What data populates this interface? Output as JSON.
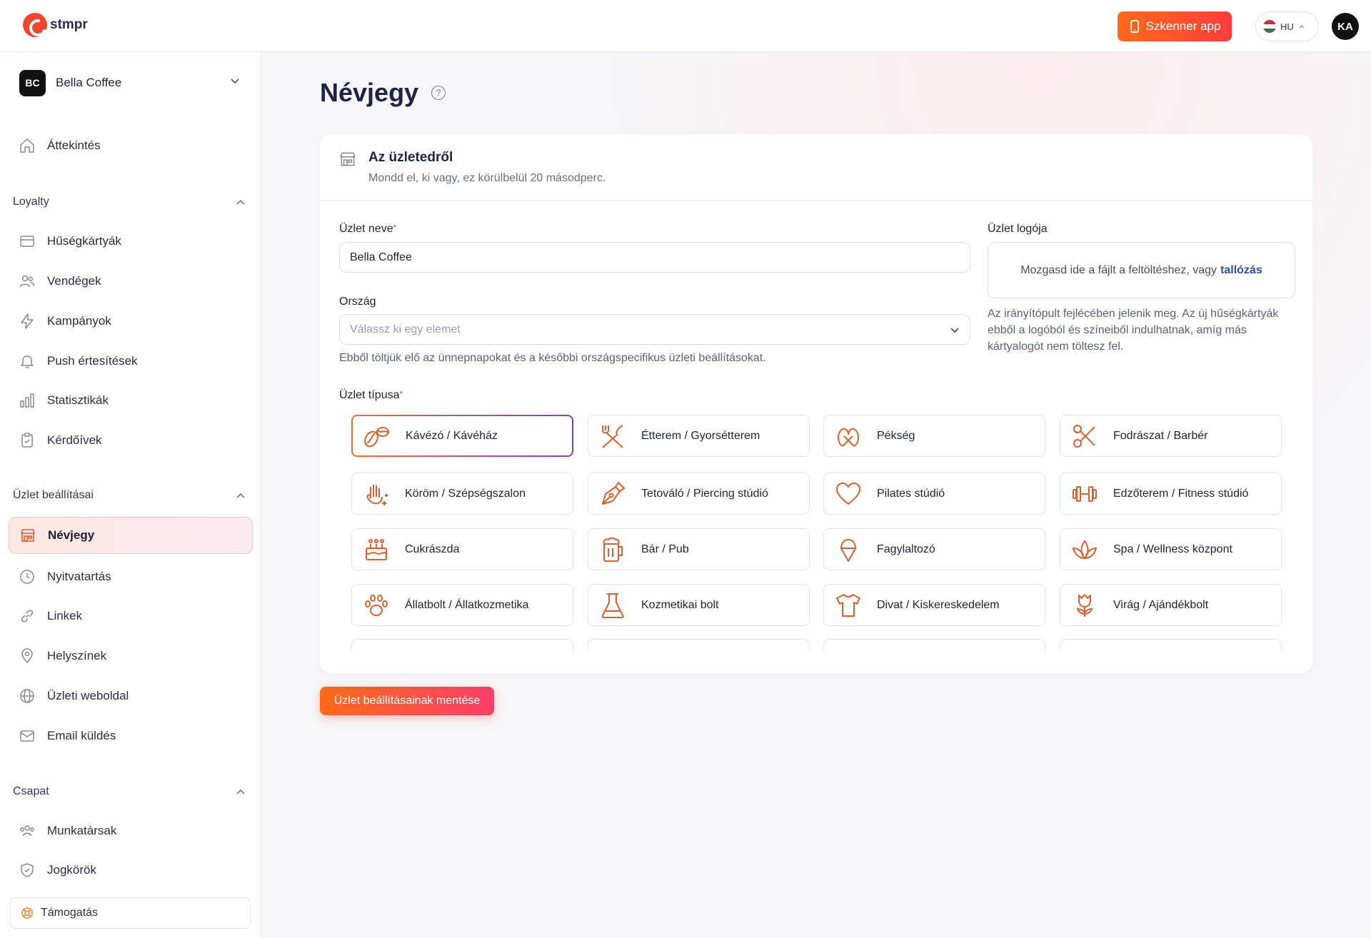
{
  "topbar": {
    "logo_text": "stmpr",
    "scanner_button": "Szkenner app",
    "language": "HU",
    "user_initials": "KA"
  },
  "sidebar": {
    "business": {
      "initials": "BC",
      "name": "Bella Coffee"
    },
    "overview": "Áttekintés",
    "sections": {
      "loyalty": "Loyalty",
      "business_settings": "Üzlet beállításai",
      "team": "Csapat"
    },
    "loyalty_items": [
      {
        "label": "Hűségkártyák",
        "icon": "card-icon"
      },
      {
        "label": "Vendégek",
        "icon": "users-icon"
      },
      {
        "label": "Kampányok",
        "icon": "bolt-icon"
      },
      {
        "label": "Push értesítések",
        "icon": "bell-icon"
      },
      {
        "label": "Statisztikák",
        "icon": "chart-icon"
      },
      {
        "label": "Kérdőívek",
        "icon": "clipboard-icon"
      }
    ],
    "business_items": [
      {
        "label": "Névjegy",
        "icon": "store-icon",
        "active": true
      },
      {
        "label": "Nyitvatartás",
        "icon": "clock-icon"
      },
      {
        "label": "Linkek",
        "icon": "link-icon"
      },
      {
        "label": "Helyszínek",
        "icon": "pin-icon"
      },
      {
        "label": "Üzleti weboldal",
        "icon": "globe-icon"
      },
      {
        "label": "Email küldés",
        "icon": "mail-icon"
      }
    ],
    "team_items": [
      {
        "label": "Munkatársak",
        "icon": "team-icon"
      },
      {
        "label": "Jogkörök",
        "icon": "shield-icon"
      }
    ],
    "support": "Támogatás"
  },
  "main": {
    "title": "Névjegy",
    "card": {
      "title": "Az üzletedről",
      "subtitle": "Mondd el, ki vagy, ez körülbelül 20 másodperc."
    },
    "form": {
      "name_label": "Üzlet neve",
      "name_value": "Bella Coffee",
      "country_label": "Ország",
      "country_placeholder": "Válassz ki egy elemet",
      "country_hint": "Ebből töltjük elő az ünnepnapokat és a későbbi országspecifikus üzleti beállításokat.",
      "logo_label": "Üzlet logója",
      "dropzone_text": "Mozgasd ide a fájlt a feltöltéshez, vagy",
      "dropzone_link": "tallózás",
      "logo_hint": "Az irányítópult fejlécében jelenik meg. Az új hűségkártyák ebből a logóból és színeiből indulhatnak, amíg más kártyalogót nem töltesz fel.",
      "type_label": "Üzlet típusa"
    },
    "business_types": [
      {
        "label": "Kávézó / Kávéház",
        "icon": "coffee-bean-icon",
        "selected": true
      },
      {
        "label": "Étterem / Gyorsétterem",
        "icon": "utensils-icon"
      },
      {
        "label": "Pékség",
        "icon": "pretzel-icon"
      },
      {
        "label": "Fodrászat / Barbér",
        "icon": "scissors-icon"
      },
      {
        "label": "Köröm / Szépségszalon",
        "icon": "hand-sparkle-icon"
      },
      {
        "label": "Tetováló / Piercing stúdió",
        "icon": "pen-nib-icon"
      },
      {
        "label": "Pilates stúdió",
        "icon": "heart-icon"
      },
      {
        "label": "Edzőterem / Fitness stúdió",
        "icon": "dumbbell-icon"
      },
      {
        "label": "Cukrászda",
        "icon": "cake-icon"
      },
      {
        "label": "Bár / Pub",
        "icon": "beer-icon"
      },
      {
        "label": "Fagylaltozó",
        "icon": "ice-cream-icon"
      },
      {
        "label": "Spa / Wellness központ",
        "icon": "lotus-icon"
      },
      {
        "label": "Állatbolt / Állatkozmetika",
        "icon": "paw-icon"
      },
      {
        "label": "Kozmetikai bolt",
        "icon": "flask-icon"
      },
      {
        "label": "Divat / Kiskereskedelem",
        "icon": "shirt-icon"
      },
      {
        "label": "Virág / Ajándékbolt",
        "icon": "tulip-icon"
      }
    ],
    "save_button": "Üzlet beállításainak mentése"
  },
  "colors": {
    "accent": "#ff5a2a",
    "icon_orange": "#d9602c",
    "navy": "#1e2446"
  }
}
